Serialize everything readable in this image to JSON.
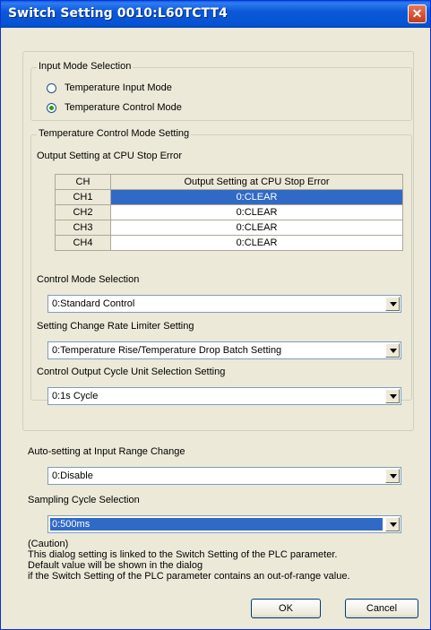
{
  "window": {
    "title": "Switch Setting 0010:L60TCTT4"
  },
  "input_mode": {
    "legend": "Input Mode Selection",
    "options": [
      {
        "label": "Temperature Input Mode",
        "checked": false
      },
      {
        "label": "Temperature Control Mode",
        "checked": true
      }
    ]
  },
  "temp_control": {
    "legend": "Temperature Control Mode Setting",
    "output_setting_label": "Output Setting at CPU Stop Error",
    "table": {
      "headers": [
        "CH",
        "Output Setting at CPU Stop Error"
      ],
      "rows": [
        {
          "ch": "CH1",
          "value": "0:CLEAR",
          "selected": true
        },
        {
          "ch": "CH2",
          "value": "0:CLEAR",
          "selected": false
        },
        {
          "ch": "CH3",
          "value": "0:CLEAR",
          "selected": false
        },
        {
          "ch": "CH4",
          "value": "0:CLEAR",
          "selected": false
        }
      ]
    },
    "control_mode": {
      "label": "Control Mode Selection",
      "value": "0:Standard Control"
    },
    "rate_limiter": {
      "label": "Setting Change Rate Limiter Setting",
      "value": "0:Temperature Rise/Temperature Drop Batch Setting"
    },
    "output_cycle": {
      "label": "Control Output Cycle Unit Selection Setting",
      "value": "0:1s Cycle"
    }
  },
  "auto_setting": {
    "label": "Auto-setting at Input Range Change",
    "value": "0:Disable"
  },
  "sampling": {
    "label": "Sampling Cycle Selection",
    "value": "0:500ms"
  },
  "caution": {
    "title": "(Caution)",
    "lines": [
      "This dialog setting is linked to the Switch Setting of the PLC parameter.",
      "Default value will be shown in the dialog",
      "if the Switch Setting of the PLC parameter contains an out-of-range value."
    ]
  },
  "buttons": {
    "ok": "OK",
    "cancel": "Cancel"
  },
  "colors": {
    "selection": "#316ac5",
    "titlebar": "#0a58d8",
    "background": "#ece9d8"
  }
}
